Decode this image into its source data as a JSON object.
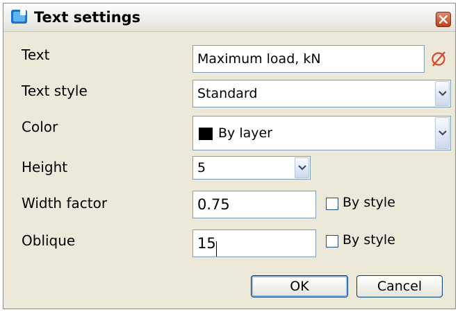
{
  "dialog": {
    "title": "Text settings",
    "icons": {
      "app": "app-icon",
      "close": "close-icon",
      "clear": "clear-text-icon",
      "dropdown": "chevron-down-icon"
    }
  },
  "fields": {
    "text": {
      "label": "Text",
      "value": "Maximum load, kN"
    },
    "text_style": {
      "label": "Text style",
      "value": "Standard"
    },
    "color": {
      "label": "Color",
      "value": "By layer",
      "swatch": "#000000"
    },
    "height": {
      "label": "Height",
      "value": "5"
    },
    "width_factor": {
      "label": "Width factor",
      "value": "0.75",
      "by_style_label": "By style",
      "by_style_checked": false
    },
    "oblique": {
      "label": "Oblique",
      "value": "15",
      "by_style_label": "By style",
      "by_style_checked": false
    }
  },
  "buttons": {
    "ok": "OK",
    "cancel": "Cancel"
  },
  "colors": {
    "clear_icon": "#d9442a",
    "accent": "#7f9db9"
  }
}
